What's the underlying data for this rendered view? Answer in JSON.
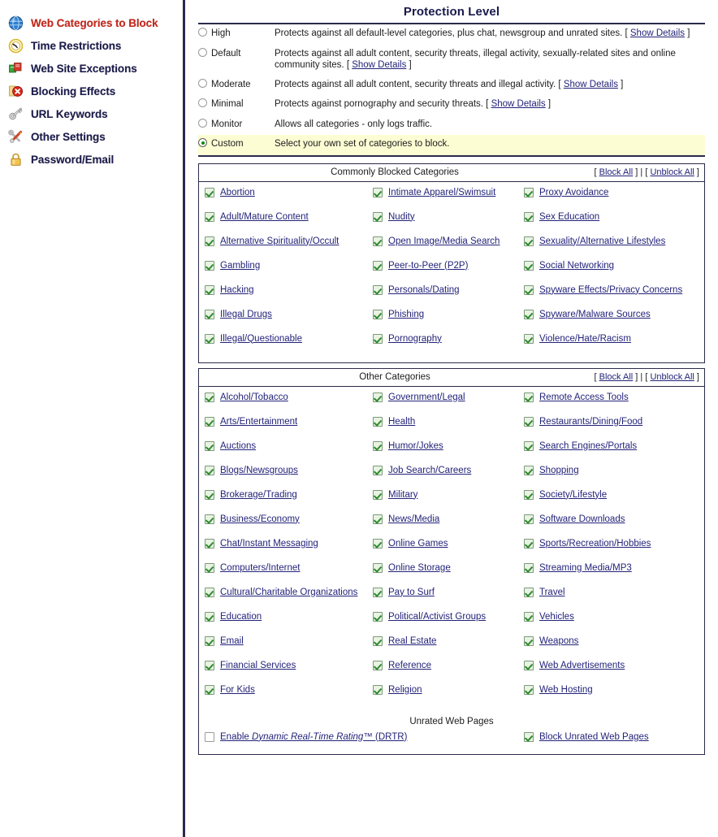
{
  "sidebar": {
    "items": [
      {
        "label": "Web Categories to Block",
        "icon": "globe-icon",
        "active": true
      },
      {
        "label": "Time Restrictions",
        "icon": "clock-icon",
        "active": false
      },
      {
        "label": "Web Site Exceptions",
        "icon": "pages-icon",
        "active": false
      },
      {
        "label": "Blocking Effects",
        "icon": "block-x-icon",
        "active": false
      },
      {
        "label": "URL Keywords",
        "icon": "key-icon",
        "active": false
      },
      {
        "label": "Other Settings",
        "icon": "tools-icon",
        "active": false
      },
      {
        "label": "Password/Email",
        "icon": "padlock-icon",
        "active": false
      }
    ]
  },
  "main": {
    "title": "Protection Level",
    "levels": [
      {
        "name": "High",
        "desc": "Protects against all default-level categories, plus chat, newsgroup and unrated sites. [ ",
        "link": "Show Details",
        "tail": " ]",
        "selected": false
      },
      {
        "name": "Default",
        "desc": "Protects against all adult content, security threats, illegal activity, sexually-related sites and online community sites. [ ",
        "link": "Show Details",
        "tail": " ]",
        "selected": false
      },
      {
        "name": "Moderate",
        "desc": "Protects against all adult content, security threats and illegal activity. [ ",
        "link": "Show Details",
        "tail": " ]",
        "selected": false
      },
      {
        "name": "Minimal",
        "desc": "Protects against pornography and security threats. [ ",
        "link": "Show Details",
        "tail": " ]",
        "selected": false
      },
      {
        "name": "Monitor",
        "desc": "Allows all categories - only logs traffic.",
        "link": "",
        "tail": "",
        "selected": false
      },
      {
        "name": "Custom",
        "desc": "Select your own set of categories to block.",
        "link": "",
        "tail": "",
        "selected": true
      }
    ],
    "commonly_blocked": {
      "heading": "Commonly Blocked Categories",
      "block_all": "Block All",
      "unblock_all": "Unblock All",
      "bracket_open": "[ ",
      "bracket_close": " ]",
      "separator": " | ",
      "rows": [
        [
          {
            "label": "Abortion",
            "checked": true
          },
          {
            "label": "Intimate Apparel/Swimsuit",
            "checked": true
          },
          {
            "label": "Proxy Avoidance",
            "checked": true
          }
        ],
        [
          {
            "label": "Adult/Mature Content",
            "checked": true
          },
          {
            "label": "Nudity",
            "checked": true
          },
          {
            "label": "Sex Education",
            "checked": true
          }
        ],
        [
          {
            "label": "Alternative Spirituality/Occult",
            "checked": true
          },
          {
            "label": "Open Image/Media Search",
            "checked": true
          },
          {
            "label": "Sexuality/Alternative Lifestyles",
            "checked": true
          }
        ],
        [
          {
            "label": "Gambling",
            "checked": true
          },
          {
            "label": "Peer-to-Peer (P2P)",
            "checked": true
          },
          {
            "label": "Social Networking",
            "checked": true
          }
        ],
        [
          {
            "label": "Hacking",
            "checked": true
          },
          {
            "label": "Personals/Dating",
            "checked": true
          },
          {
            "label": "Spyware Effects/Privacy Concerns",
            "checked": true
          }
        ],
        [
          {
            "label": "Illegal Drugs",
            "checked": true
          },
          {
            "label": "Phishing",
            "checked": true
          },
          {
            "label": "Spyware/Malware Sources",
            "checked": true
          }
        ],
        [
          {
            "label": "Illegal/Questionable",
            "checked": true
          },
          {
            "label": "Pornography",
            "checked": true
          },
          {
            "label": "Violence/Hate/Racism",
            "checked": true
          }
        ]
      ]
    },
    "other_categories": {
      "heading": "Other Categories",
      "block_all": "Block All",
      "unblock_all": "Unblock All",
      "bracket_open": "[ ",
      "bracket_close": " ]",
      "separator": " | ",
      "rows": [
        [
          {
            "label": "Alcohol/Tobacco",
            "checked": true
          },
          {
            "label": "Government/Legal",
            "checked": true
          },
          {
            "label": "Remote Access Tools",
            "checked": true
          }
        ],
        [
          {
            "label": "Arts/Entertainment",
            "checked": true
          },
          {
            "label": "Health",
            "checked": true
          },
          {
            "label": "Restaurants/Dining/Food",
            "checked": true
          }
        ],
        [
          {
            "label": "Auctions",
            "checked": true
          },
          {
            "label": "Humor/Jokes",
            "checked": true
          },
          {
            "label": "Search Engines/Portals",
            "checked": true
          }
        ],
        [
          {
            "label": "Blogs/Newsgroups",
            "checked": true
          },
          {
            "label": "Job Search/Careers",
            "checked": true
          },
          {
            "label": "Shopping",
            "checked": true
          }
        ],
        [
          {
            "label": "Brokerage/Trading",
            "checked": true
          },
          {
            "label": "Military",
            "checked": true
          },
          {
            "label": "Society/Lifestyle",
            "checked": true
          }
        ],
        [
          {
            "label": "Business/Economy",
            "checked": true
          },
          {
            "label": "News/Media",
            "checked": true
          },
          {
            "label": "Software Downloads",
            "checked": true
          }
        ],
        [
          {
            "label": "Chat/Instant Messaging",
            "checked": true
          },
          {
            "label": "Online Games",
            "checked": true
          },
          {
            "label": "Sports/Recreation/Hobbies",
            "checked": true
          }
        ],
        [
          {
            "label": "Computers/Internet",
            "checked": true
          },
          {
            "label": "Online Storage",
            "checked": true
          },
          {
            "label": "Streaming Media/MP3",
            "checked": true
          }
        ],
        [
          {
            "label": "Cultural/Charitable Organizations",
            "checked": true
          },
          {
            "label": "Pay to Surf",
            "checked": true
          },
          {
            "label": "Travel",
            "checked": true
          }
        ],
        [
          {
            "label": "Education",
            "checked": true
          },
          {
            "label": "Political/Activist Groups",
            "checked": true
          },
          {
            "label": "Vehicles",
            "checked": true
          }
        ],
        [
          {
            "label": "Email",
            "checked": true
          },
          {
            "label": "Real Estate",
            "checked": true
          },
          {
            "label": "Weapons",
            "checked": true
          }
        ],
        [
          {
            "label": "Financial Services",
            "checked": true
          },
          {
            "label": "Reference",
            "checked": true
          },
          {
            "label": "Web Advertisements",
            "checked": true
          }
        ],
        [
          {
            "label": "For Kids",
            "checked": true
          },
          {
            "label": "Religion",
            "checked": true
          },
          {
            "label": "Web Hosting",
            "checked": true
          }
        ]
      ]
    },
    "unrated": {
      "heading": "Unrated Web Pages",
      "drtr_prefix": "Enable ",
      "drtr_italic": "Dynamic Real-Time Rating",
      "drtr_suffix": "™ (DRTR)",
      "drtr_checked": false,
      "block_unrated_label": "Block Unrated Web Pages",
      "block_unrated_checked": true
    }
  },
  "colors": {
    "active_nav": "#c7261a",
    "nav_text": "#1b1b4b",
    "link": "#23237a",
    "border": "#2b2b4e",
    "selected_row_bg": "#fdfdd4",
    "checkbox_fill": "#e8f3e2",
    "check_green": "#2f8a2f"
  }
}
